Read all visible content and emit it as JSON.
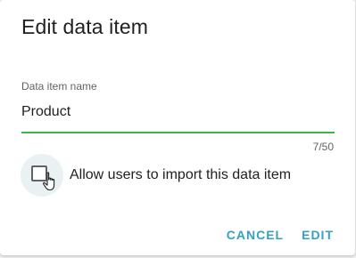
{
  "dialog": {
    "title": "Edit data item",
    "field": {
      "label": "Data item name",
      "value": "Product",
      "counter": "7/50"
    },
    "checkbox": {
      "label": "Allow users to import this data item",
      "checked": false
    },
    "actions": {
      "cancel_label": "CANCEL",
      "edit_label": "EDIT"
    }
  },
  "colors": {
    "accent": "#35a1c2",
    "underline": "#3cb64b",
    "text": "#202124"
  }
}
